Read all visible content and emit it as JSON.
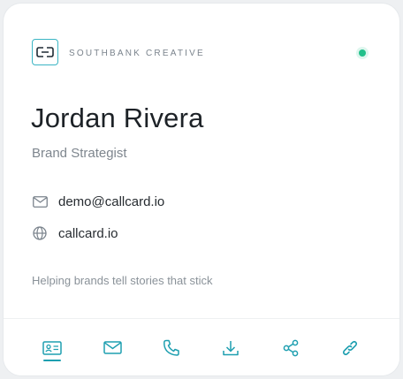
{
  "company": {
    "name": "SOUTHBANK CREATIVE",
    "status": "online"
  },
  "profile": {
    "name": "Jordan Rivera",
    "title": "Brand Strategist",
    "email": "demo@callcard.io",
    "website": "callcard.io",
    "tagline": "Helping brands tell stories that stick"
  },
  "icons": {
    "email": "mail-icon",
    "website": "globe-icon",
    "tabs": [
      "contact-card-icon",
      "mail-icon",
      "phone-icon",
      "download-icon",
      "share-icon",
      "link-icon"
    ]
  },
  "colors": {
    "accent": "#1e9fb0",
    "status": "#22c08a",
    "text": "#1d2227",
    "muted": "#7e868e"
  }
}
